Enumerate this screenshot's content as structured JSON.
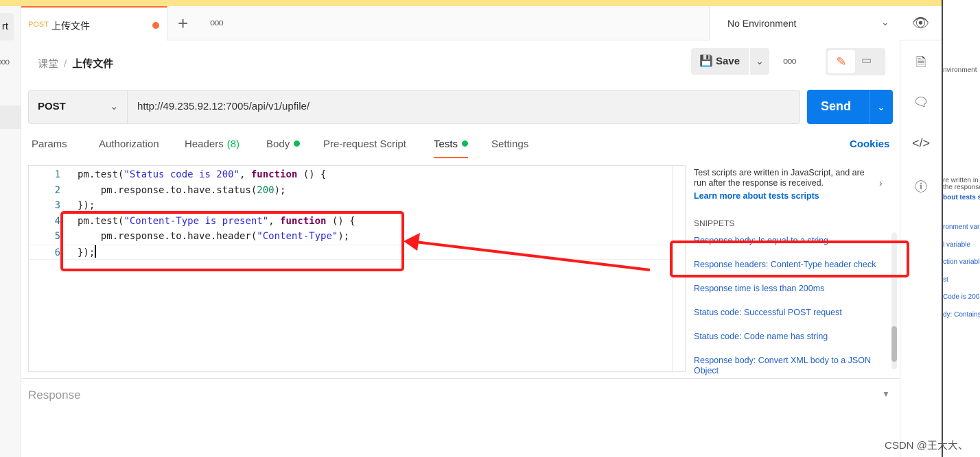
{
  "left_strip": {
    "button_label": "rt",
    "dots": "ooo"
  },
  "tab": {
    "method": "POST",
    "title": "上传文件",
    "unsaved_color": "#ff6c37"
  },
  "tabbar": {
    "new_tab": "+",
    "more": "ooo"
  },
  "environment": {
    "selected": "No Environment"
  },
  "breadcrumb": {
    "collection": "课堂",
    "separator": "/",
    "request": "上传文件"
  },
  "toolbar": {
    "save_label": "Save",
    "more": "ooo"
  },
  "request": {
    "method": "POST",
    "url": "http://49.235.92.12:7005/api/v1/upfile/",
    "send_label": "Send"
  },
  "request_tabs": [
    {
      "label": "Params"
    },
    {
      "label": "Authorization"
    },
    {
      "label": "Headers",
      "count": "(8)"
    },
    {
      "label": "Body",
      "dot": true
    },
    {
      "label": "Pre-request Script"
    },
    {
      "label": "Tests",
      "dot": true,
      "active": true
    },
    {
      "label": "Settings"
    }
  ],
  "cookies_label": "Cookies",
  "editor": {
    "lines": [
      [
        [
          "",
          "pm.test("
        ],
        [
          "str",
          "\"Status code is 200\""
        ],
        [
          "",
          ", "
        ],
        [
          "kw",
          "function"
        ],
        [
          "",
          " () {"
        ]
      ],
      [
        [
          "",
          "    pm.response.to.have.status("
        ],
        [
          "num",
          "200"
        ],
        [
          "",
          ");"
        ]
      ],
      [
        [
          "",
          "});"
        ]
      ],
      [
        [
          "",
          "pm.test("
        ],
        [
          "str",
          "\"Content-Type is present\""
        ],
        [
          "",
          ", "
        ],
        [
          "kw",
          "function"
        ],
        [
          "",
          " () {"
        ]
      ],
      [
        [
          "",
          "    pm.response.to.have.header("
        ],
        [
          "str",
          "\"Content-Type\""
        ],
        [
          "",
          ");"
        ]
      ],
      [
        [
          "",
          "});"
        ]
      ]
    ]
  },
  "snippets_panel": {
    "description": "Test scripts are written in JavaScript, and are run after the response is received.",
    "learn_more": "Learn more about tests scripts",
    "heading": "SNIPPETS",
    "items": [
      "Response body: Is equal to a string",
      "Response headers: Content-Type header check",
      "Response time is less than 200ms",
      "Status code: Successful POST request",
      "Status code: Code name has string",
      "Response body: Convert XML body to a JSON Object"
    ]
  },
  "response": {
    "label": "Response"
  },
  "background_window": {
    "fragments": [
      "nvironment",
      "re written in .",
      "the response",
      "bout tests sc",
      "ronment varia",
      "l variable",
      "ction variable",
      "st",
      "Code is 200",
      "dy: Contains"
    ]
  },
  "watermark": "CSDN @王大大、",
  "colors": {
    "accent": "#ff6c37",
    "send": "#097bed",
    "link": "#0265d2",
    "annotation": "#ff1a1a"
  }
}
